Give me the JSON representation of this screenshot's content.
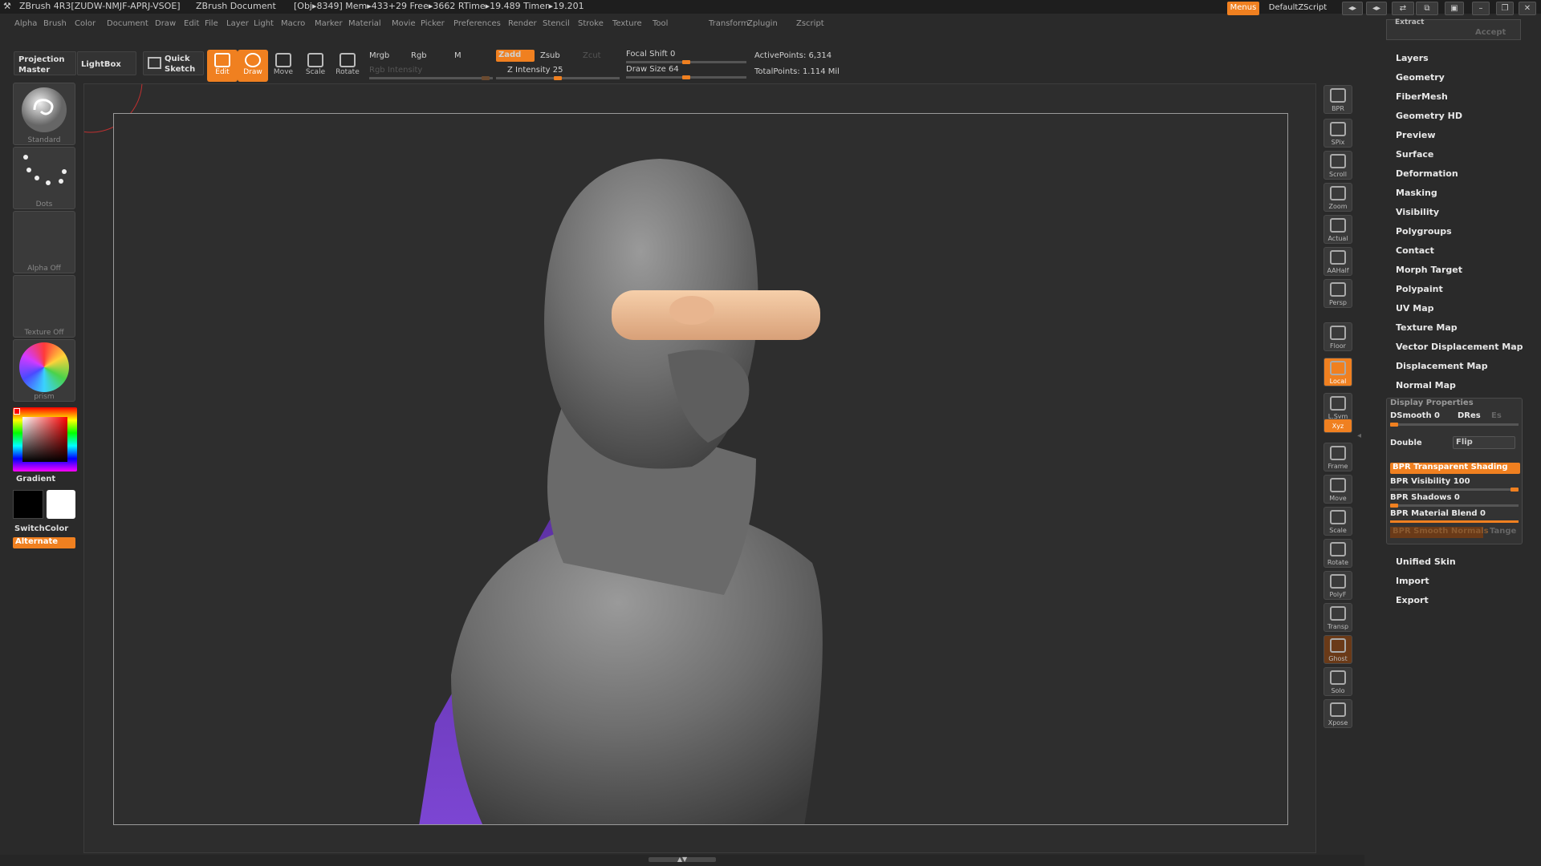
{
  "titlebar": {
    "app": "ZBrush 4R3[ZUDW-NMJF-APRJ-VSOE]",
    "doc": "ZBrush Document",
    "stats": "[Obj▸8349] Mem▸433+29 Free▸3662 RTime▸19.489 Timer▸19.201",
    "menus_btn": "Menus",
    "script": "DefaultZScript"
  },
  "menubar": [
    "Alpha",
    "Brush",
    "Color",
    "Document",
    "Draw",
    "Edit",
    "File",
    "Layer",
    "Light",
    "Macro",
    "Marker",
    "Material",
    "Movie",
    "Picker",
    "Preferences",
    "Render",
    "Stencil",
    "Stroke",
    "Texture",
    "Tool",
    "Transform",
    "Zplugin",
    "Zscript"
  ],
  "toolbar": {
    "projection_master": "Projection Master",
    "lightbox": "LightBox",
    "quick_sketch": "Quick Sketch",
    "edit": "Edit",
    "draw": "Draw",
    "move": "Move",
    "scale": "Scale",
    "rotate": "Rotate",
    "mrgb": "Mrgb",
    "rgb": "Rgb",
    "m": "M",
    "rgb_intensity": "Rgb Intensity",
    "zadd": "Zadd",
    "zsub": "Zsub",
    "zcut": "Zcut",
    "z_intensity": "Z Intensity 25",
    "focal_shift": "Focal Shift 0",
    "draw_size": "Draw Size 64",
    "active_points": "ActivePoints: 6,314",
    "total_points": "TotalPoints: 1.114 Mil"
  },
  "leftshelf": {
    "brush": "Standard",
    "stroke": "Dots",
    "alpha": "Alpha Off",
    "texture": "Texture Off",
    "material": "prism",
    "gradient": "Gradient",
    "switchcolor": "SwitchColor",
    "alternate": "Alternate"
  },
  "rightshelf": [
    "BPR",
    "SPix",
    "Scroll",
    "Zoom",
    "Actual",
    "AAHalf",
    "Persp",
    "Floor",
    "Local",
    "L.Sym",
    "Xyz",
    "Frame",
    "Move",
    "Scale",
    "Rotate",
    "PolyF",
    "Transp",
    "Ghost",
    "Solo",
    "Xpose"
  ],
  "rightpanel": {
    "extract": "Extract",
    "accept": "Accept",
    "items_top": [
      "Layers",
      "Geometry",
      "FiberMesh",
      "Geometry HD",
      "Preview",
      "Surface",
      "Deformation",
      "Masking",
      "Visibility",
      "Polygroups",
      "Contact",
      "Morph Target",
      "Polypaint",
      "UV Map",
      "Texture Map",
      "Vector Displacement Map",
      "Displacement Map",
      "Normal Map"
    ],
    "display_properties": {
      "title": "Display Properties",
      "dsmooth": "DSmooth 0",
      "dres": "DRes",
      "es": "Es",
      "double": "Double",
      "flip": "Flip",
      "bpr_transparent": "BPR Transparent Shading",
      "bpr_visibility": "BPR Visibility 100",
      "bpr_shadows": "BPR Shadows 0",
      "bpr_material_blend": "BPR Material Blend 0",
      "bpr_smooth_normals": "BPR Smooth Normals",
      "tange": "Tange"
    },
    "items_bottom": [
      "Unified Skin",
      "Import",
      "Export"
    ]
  },
  "colors": {
    "accent": "#f08020",
    "panel": "#2a2a2a",
    "hair": "#7a3fd6",
    "goggles": "#f0c09a"
  }
}
